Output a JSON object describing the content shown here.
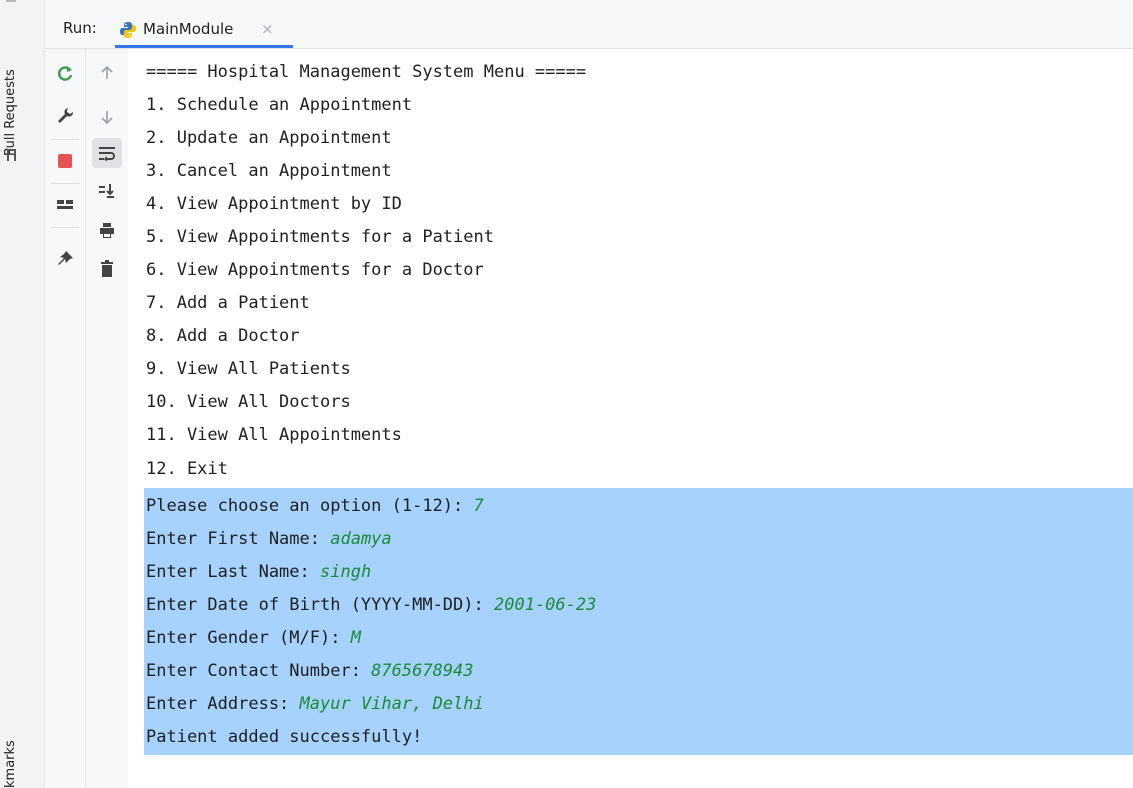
{
  "side_stripe": {
    "pull_requests_label": "Pull Requests",
    "bookmarks_label": "kmarks"
  },
  "header": {
    "run_label": "Run:",
    "tab_label": "MainModule",
    "tab_close": "×"
  },
  "toolbar": {
    "rerun_icon": "rerun-icon",
    "settings_icon": "wrench-icon",
    "stop_icon": "stop-icon",
    "layout_icon": "layout-icon",
    "pin_icon": "pin-icon",
    "up_icon": "arrow-up-icon",
    "down_icon": "arrow-down-icon",
    "softwrap_icon": "soft-wrap-icon",
    "scroll_end_icon": "scroll-to-end-icon",
    "print_icon": "print-icon",
    "clear_icon": "trash-icon"
  },
  "console": {
    "menu_lines": [
      "===== Hospital Management System Menu =====",
      "1. Schedule an Appointment",
      "2. Update an Appointment",
      "3. Cancel an Appointment",
      "4. View Appointment by ID",
      "5. View Appointments for a Patient",
      "6. View Appointments for a Doctor",
      "7. Add a Patient",
      "8. Add a Doctor",
      "9. View All Patients",
      "10. View All Doctors",
      "11. View All Appointments",
      "12. Exit"
    ],
    "session": [
      {
        "prompt": "Please choose an option (1-12): ",
        "input": "7"
      },
      {
        "prompt": "Enter First Name: ",
        "input": "adamya"
      },
      {
        "prompt": "Enter Last Name: ",
        "input": "singh"
      },
      {
        "prompt": "Enter Date of Birth (YYYY-MM-DD): ",
        "input": "2001-06-23"
      },
      {
        "prompt": "Enter Gender (M/F): ",
        "input": "M"
      },
      {
        "prompt": "Enter Contact Number: ",
        "input": "8765678943"
      },
      {
        "prompt": "Enter Address: ",
        "input": "Mayur Vihar, Delhi"
      },
      {
        "prompt": "Patient added successfully!",
        "input": ""
      }
    ]
  },
  "colors": {
    "selection": "#a6d2fb",
    "user_input": "#1b8a3a",
    "tab_underline": "#3574f0",
    "stop": "#e55353"
  }
}
